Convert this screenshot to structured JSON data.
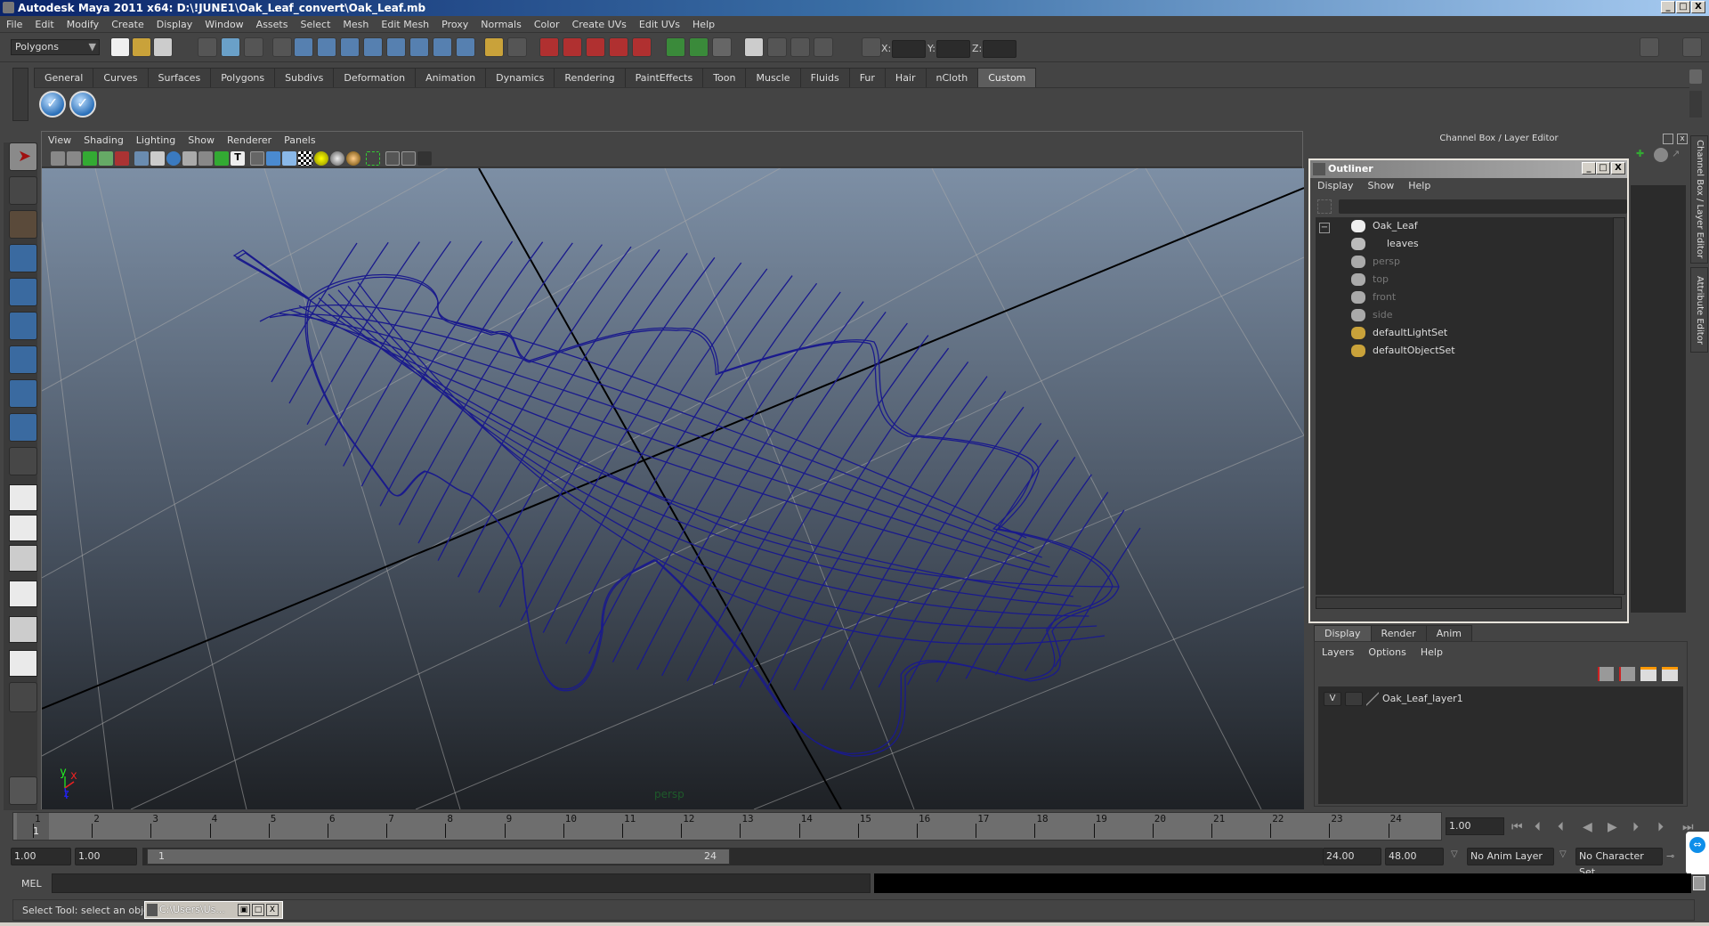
{
  "window": {
    "title": "Autodesk Maya 2011 x64: D:\\!JUNE1\\Oak_Leaf_convert\\Oak_Leaf.mb"
  },
  "menubar": [
    "File",
    "Edit",
    "Modify",
    "Create",
    "Display",
    "Window",
    "Assets",
    "Select",
    "Mesh",
    "Edit Mesh",
    "Proxy",
    "Normals",
    "Color",
    "Create UVs",
    "Edit UVs",
    "Help"
  ],
  "statusline": {
    "mode": "Polygons",
    "x_label": "X:",
    "y_label": "Y:",
    "z_label": "Z:",
    "x_value": "",
    "y_value": "",
    "z_value": ""
  },
  "shelf": {
    "tabs": [
      "General",
      "Curves",
      "Surfaces",
      "Polygons",
      "Subdivs",
      "Deformation",
      "Animation",
      "Dynamics",
      "Rendering",
      "PaintEffects",
      "Toon",
      "Muscle",
      "Fluids",
      "Fur",
      "Hair",
      "nCloth",
      "Custom"
    ],
    "active_tab": "Custom",
    "buttons": [
      "check-icon",
      "check-icon"
    ]
  },
  "toolbox": [
    "select-tool",
    "lasso-tool",
    "paint-select-tool",
    "move-tool-soft",
    "rotate-tool",
    "scale-tool",
    "universal-manipulator",
    "soft-modification-tool",
    "show-manipulator",
    "last-tool"
  ],
  "viewport": {
    "menus": [
      "View",
      "Shading",
      "Lighting",
      "Show",
      "Renderer",
      "Panels"
    ],
    "camera_label": "persp",
    "axis": {
      "y": "y",
      "x": "x",
      "z": "z"
    },
    "wire_color": "#1a1a8c"
  },
  "channel_box": {
    "title": "Channel Box / Layer Editor",
    "side_tabs": [
      "Channel Box / Layer Editor",
      "Attribute Editor"
    ]
  },
  "outliner": {
    "title": "Outliner",
    "menus": [
      "Display",
      "Show",
      "Help"
    ],
    "filter_value": "",
    "items": [
      {
        "name": "Oak_Leaf",
        "icon": "transform-icon",
        "dim": false,
        "indent": 0
      },
      {
        "name": "leaves",
        "icon": "mesh-icon",
        "dim": false,
        "indent": 1
      },
      {
        "name": "persp",
        "icon": "camera-icon",
        "dim": true,
        "indent": 0
      },
      {
        "name": "top",
        "icon": "camera-icon",
        "dim": true,
        "indent": 0
      },
      {
        "name": "front",
        "icon": "camera-icon",
        "dim": true,
        "indent": 0
      },
      {
        "name": "side",
        "icon": "camera-icon",
        "dim": true,
        "indent": 0
      },
      {
        "name": "defaultLightSet",
        "icon": "set-icon",
        "dim": false,
        "indent": 0
      },
      {
        "name": "defaultObjectSet",
        "icon": "set-icon",
        "dim": false,
        "indent": 0
      }
    ]
  },
  "layer_editor": {
    "tabs": [
      "Display",
      "Render",
      "Anim"
    ],
    "active_tab": "Display",
    "menus": [
      "Layers",
      "Options",
      "Help"
    ],
    "layers": [
      {
        "visible": "V",
        "name": "Oak_Leaf_layer1"
      }
    ]
  },
  "timeline": {
    "ticks": [
      "1",
      "2",
      "3",
      "4",
      "5",
      "6",
      "7",
      "8",
      "9",
      "10",
      "11",
      "12",
      "13",
      "14",
      "15",
      "16",
      "17",
      "18",
      "19",
      "20",
      "21",
      "22",
      "23",
      "24"
    ],
    "current_frame_marker": "1",
    "current_time": "1.00"
  },
  "range": {
    "start_time": "1.00",
    "playback_start": "1.00",
    "slider_start": "1",
    "slider_end": "24",
    "playback_end": "24.00",
    "end_time": "48.00",
    "anim_layer": "No Anim Layer",
    "character_set": "No Character Set"
  },
  "command_line": {
    "label": "MEL",
    "value": "",
    "output": ""
  },
  "help_line": {
    "text": "Select Tool: select an object"
  },
  "minimized_window": {
    "title": "C:\\Users\\Us..."
  }
}
